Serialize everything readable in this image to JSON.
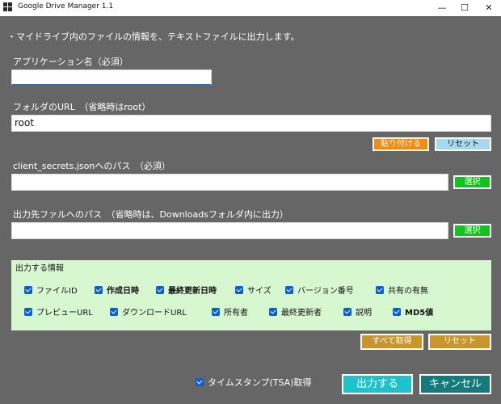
{
  "window": {
    "title": "Google Drive Manager 1.1",
    "minimize": "—",
    "maximize": "☐",
    "close": "✕"
  },
  "description": "・マイドライブ内のファイルの情報を、テキストファイルに出力します。",
  "app_name": {
    "label": "アプリケーション名（必須）",
    "value": ""
  },
  "folder_url": {
    "label": "フォルダのURL　（省略時はroot）",
    "value": "root",
    "paste_button": "貼り付ける",
    "reset_button": "リセット"
  },
  "client_secrets": {
    "label": "client_secrets.jsonへのパス　（必須）",
    "value": "",
    "select_button": "選択"
  },
  "output_file": {
    "label": "出力先ファルへのパス　（省略時は、Downloadsフォルダ内に出力）",
    "value": "",
    "select_button": "選択"
  },
  "output_info": {
    "title": "出力する情報",
    "row1": [
      {
        "label": "ファイルID",
        "checked": true,
        "bold": false
      },
      {
        "label": "作成日時",
        "checked": true,
        "bold": true
      },
      {
        "label": "最終更新日時",
        "checked": true,
        "bold": true
      },
      {
        "label": "サイズ",
        "checked": true,
        "bold": false
      },
      {
        "label": "バージョン番号",
        "checked": true,
        "bold": false
      },
      {
        "label": "共有の有無",
        "checked": true,
        "bold": false
      }
    ],
    "row2": [
      {
        "label": "プレビューURL",
        "checked": true,
        "bold": false
      },
      {
        "label": "ダウンロードURL",
        "checked": true,
        "bold": false
      },
      {
        "label": "所有者",
        "checked": true,
        "bold": false
      },
      {
        "label": "最終更新者",
        "checked": true,
        "bold": false
      },
      {
        "label": "説明",
        "checked": true,
        "bold": false
      },
      {
        "label": "MD5値",
        "checked": true,
        "bold": true
      }
    ],
    "select_all_button": "すべて取得",
    "reset_button": "リセット"
  },
  "timestamp": {
    "label": "タイムスタンプ(TSA)取得",
    "checked": true
  },
  "actions": {
    "output_button": "出力する",
    "cancel_button": "キャンセル"
  },
  "colors": {
    "background": "#666666",
    "paste": "#f28a14",
    "reset_blue": "#a8d8ee",
    "select_green": "#0fc41a",
    "reset_gold": "#c9962b",
    "output_teal": "#1cc4c9",
    "cancel_teal": "#137a7e",
    "info_panel": "#d6f7d0"
  }
}
